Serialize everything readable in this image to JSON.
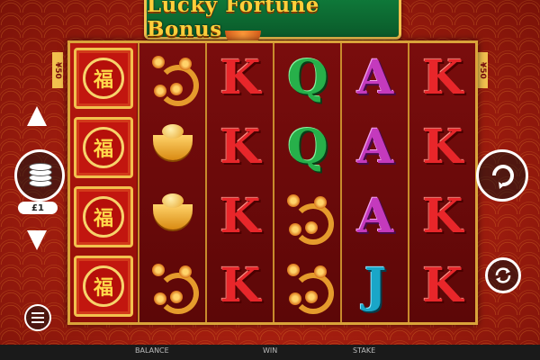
{
  "game": {
    "title": "Lucky Fortune Bonus"
  },
  "side_tags": {
    "left": "¥50",
    "right": "¥50"
  },
  "reels": [
    {
      "symbols": [
        "fu",
        "fu",
        "fu",
        "fu"
      ],
      "expanded_wild": true
    },
    {
      "symbols": [
        "dragon",
        "ingot",
        "ingot",
        "dragon"
      ]
    },
    {
      "symbols": [
        "K",
        "K",
        "K",
        "K"
      ]
    },
    {
      "symbols": [
        "Q",
        "Q",
        "dragon",
        "dragon"
      ]
    },
    {
      "symbols": [
        "A",
        "A",
        "A",
        "J"
      ]
    },
    {
      "symbols": [
        "K",
        "K",
        "K",
        "K"
      ]
    }
  ],
  "symbol_text": {
    "fu": "福"
  },
  "controls": {
    "stake_value": "£1",
    "balance_label": "BALANCE",
    "win_label": "WIN",
    "stake_label": "STAKE"
  },
  "icons": [
    "up-arrow-icon",
    "down-arrow-icon",
    "chips-icon",
    "spin-icon",
    "autoplay-icon",
    "menu-icon"
  ]
}
